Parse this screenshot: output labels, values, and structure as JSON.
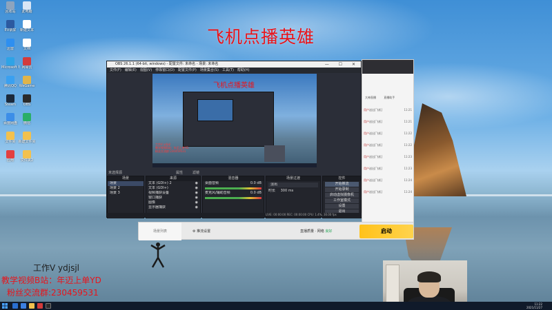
{
  "overlay": {
    "title": "飞机点播英雄",
    "contact_line1": "工作V ydjsjl",
    "contact_line2": "教学视频B站：年迈上单YD",
    "contact_line3": "粉丝交流群:230459531"
  },
  "obs": {
    "window_title": "OBS 26.1.1 (64-bit, windows) - 配置文件: 未命名 - 场景: 未命名",
    "window_controls": "— ☐ ✕",
    "menu": [
      "文件(F)",
      "编辑(E)",
      "视图(V)",
      "停靠窗口(D)",
      "配置文件(P)",
      "场景集合(S)",
      "工具(T)",
      "帮助(H)"
    ],
    "preview_title": "飞机点播英雄",
    "preview_caption_lines": [
      "工作V ydjsjl",
      "教学视频B站：年迈上单YD",
      "粉丝交流群:230459531"
    ],
    "no_source_label": "未选择源",
    "properties_label": "属性",
    "filters_label": "滤镜",
    "panels": {
      "scenes": {
        "header": "场景",
        "items": [
          "场景",
          "场景 2",
          "场景 3"
        ]
      },
      "sources": {
        "header": "来源",
        "items": [
          "文本 (GDI+) 2",
          "文本 (GDI+)",
          "视频捕获设备",
          "窗口捕获",
          "图像",
          "显示器捕获"
        ]
      },
      "mixer": {
        "header": "混音器",
        "tracks": [
          {
            "name": "桌面音频",
            "level": "0.0 dB"
          },
          {
            "name": "麦克风/辅助音频",
            "level": "0.0 dB"
          }
        ]
      },
      "transitions": {
        "header": "场景过渡",
        "type": "淡出",
        "duration_label": "时长",
        "duration": "300 ms"
      },
      "controls": {
        "header": "控件",
        "buttons": [
          "开始推流",
          "开始录制",
          "启动虚拟摄像机",
          "工作室模式",
          "设置",
          "退出"
        ]
      }
    },
    "status": "LIVE: 00:00:00  REC: 00:00:00  CPU: 1.4%, 30.00 fps"
  },
  "helper_app": {
    "left_label": "场景列表",
    "settings_label": "推流设置",
    "quality_label": "直播质量 · 网络",
    "quality_value": "良好",
    "start_label": "启动"
  },
  "side_app": {
    "tabs": [
      "大神直播",
      "直播助手"
    ],
    "chat": [
      {
        "user": "用户",
        "text": "送出[飞机]",
        "time": "11:21"
      },
      {
        "user": "用户",
        "text": "送出[飞机]",
        "time": "11:21"
      },
      {
        "user": "用户",
        "text": "送出[飞机]",
        "time": "11:22"
      },
      {
        "user": "用户",
        "text": "送出[飞机]",
        "time": "11:22"
      },
      {
        "user": "用户",
        "text": "送出[飞机]",
        "time": "11:23"
      },
      {
        "user": "用户",
        "text": "送出[飞机]",
        "time": "11:23"
      },
      {
        "user": "用户",
        "text": "送出[飞机]",
        "time": "11:24"
      },
      {
        "user": "用户",
        "text": "送出[飞机]",
        "time": "11:24"
      }
    ]
  },
  "desktop_icons": [
    {
      "name": "回收站",
      "color": "#8da4be"
    },
    {
      "name": "此电脑",
      "color": "#d9e6f5"
    },
    {
      "name": "EV录屏",
      "color": "#2c5aa0"
    },
    {
      "name": "新建文本",
      "color": "#ffffff"
    },
    {
      "name": "迅雷",
      "color": "#2e8ff0"
    },
    {
      "name": "文档",
      "color": "#ffffff"
    },
    {
      "name": "Microsoft Edge",
      "color": "#2fa3e6"
    },
    {
      "name": "网易云",
      "color": "#d33b3b"
    },
    {
      "name": "腾讯QQ",
      "color": "#3aa0f0"
    },
    {
      "name": "WeGame",
      "color": "#e0b44a"
    },
    {
      "name": "Steam",
      "color": "#1c2a3c"
    },
    {
      "name": "OBS",
      "color": "#2b2b2b"
    },
    {
      "name": "百度网盘",
      "color": "#3c8ee8"
    },
    {
      "name": "微信",
      "color": "#2aae67"
    },
    {
      "name": "文件夹",
      "color": "#f2c14e"
    },
    {
      "name": "新建文件夹",
      "color": "#f2c14e"
    },
    {
      "name": "应用",
      "color": "#e34040"
    },
    {
      "name": "文件夹2",
      "color": "#f2c14e"
    }
  ],
  "taskbar": {
    "time": "11:22",
    "date": "2021/11/27"
  }
}
